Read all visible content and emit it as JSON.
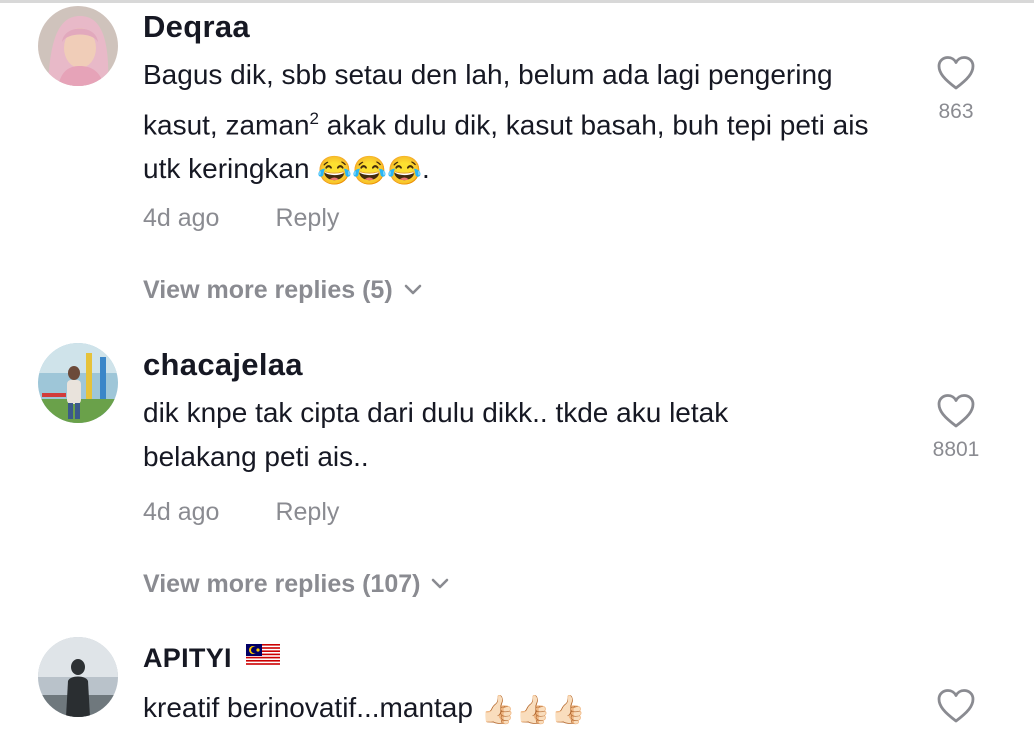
{
  "comments": [
    {
      "username": "Deqraa",
      "text_parts": [
        "Bagus dik, sbb setau den lah, belum ada lagi pengering kasut, zaman",
        "2",
        " akak dulu dik, kasut basah, buh tepi peti ais utk keringkan ",
        "."
      ],
      "emoji": [
        "😂",
        "😂",
        "😂"
      ],
      "time": "4d ago",
      "reply_label": "Reply",
      "likes": "863",
      "view_more": "View more replies (5)"
    },
    {
      "username": "chacajelaa",
      "text": "dik knpe tak cipta dari dulu dikk.. tkde aku letak belakang peti ais..",
      "time": "4d ago",
      "reply_label": "Reply",
      "likes": "8801",
      "view_more": "View more replies (107)"
    },
    {
      "username": "APITYI",
      "username_suffix_emoji": "🇲🇾",
      "text": "kreatif berinovatif...mantap ",
      "emoji": [
        "👍🏻",
        "👍🏻",
        "👍🏻"
      ]
    }
  ],
  "icons": {
    "like": "heart-outline-icon",
    "expand": "chevron-down-icon",
    "laugh": "tears-of-joy-emoji",
    "thumbs": "thumbs-up-emoji",
    "flag": "malaysia-flag-emoji"
  },
  "colors": {
    "text": "#161823",
    "secondary": "#8a8b91",
    "divider": "#d8d8d8"
  }
}
